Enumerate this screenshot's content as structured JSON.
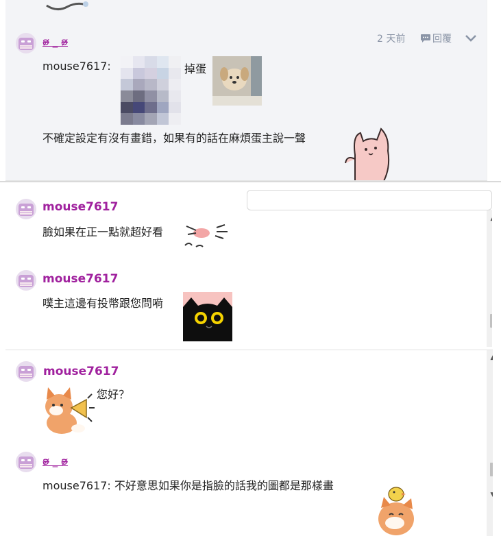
{
  "top_comment": {
    "username": "ʚ̴̶̷̷ _ ʚ̴̶̷̷",
    "timestamp": "2 天前",
    "reply_label": "回覆",
    "mention": "mouse7617:",
    "text_after_image": "掉蛋",
    "body": "不確定設定有沒有畫錯，如果有的話在麻煩蛋主說一聲"
  },
  "mid_comments": [
    {
      "username": "mouse7617",
      "text": "臉如果在正一點就超好看"
    },
    {
      "username": "mouse7617",
      "text": "噗主這邊有投幣跟您問嗬"
    }
  ],
  "bottom_comments": [
    {
      "username": "mouse7617",
      "text": "您好？"
    },
    {
      "username": "ʚ̴̶̷̷ _ ʚ̴̶̷̷",
      "text": "mouse7617: 不好意思如果你是指臉的話我的圖都是那樣畫"
    }
  ]
}
